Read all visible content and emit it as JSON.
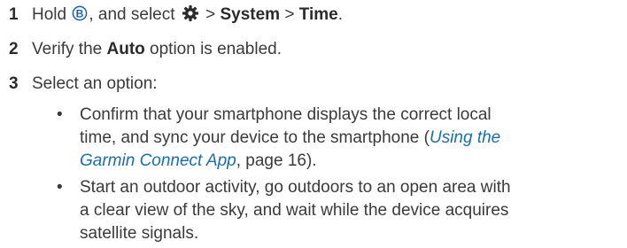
{
  "steps": [
    {
      "number": "1",
      "pre": "Hold",
      "button_icon": "b-button-icon",
      "mid": ", and select",
      "settings_icon": "gear-icon",
      "sep1": " > ",
      "system": "System",
      "sep2": " > ",
      "time": "Time",
      "end": "."
    },
    {
      "number": "2",
      "pre": "Verify the ",
      "auto": "Auto",
      "post": " option is enabled."
    },
    {
      "number": "3",
      "text": "Select an option:"
    }
  ],
  "bullets": [
    {
      "marker": "•",
      "line1": "Confirm that your smartphone displays the correct local",
      "line2_pre": "time, and sync your device to the smartphone (",
      "link1": "Using the",
      "link2": "Garmin Connect App",
      "line3_post": ", page 16)."
    },
    {
      "marker": "•",
      "line1": "Start an outdoor activity, go outdoors to an open area with",
      "line2": "a clear view of the sky, and wait while the device acquires",
      "line3": "satellite signals."
    }
  ],
  "colors": {
    "text": "#3a3a3a",
    "link": "#1c6ea8",
    "icon_blue": "#1f5fa8"
  }
}
